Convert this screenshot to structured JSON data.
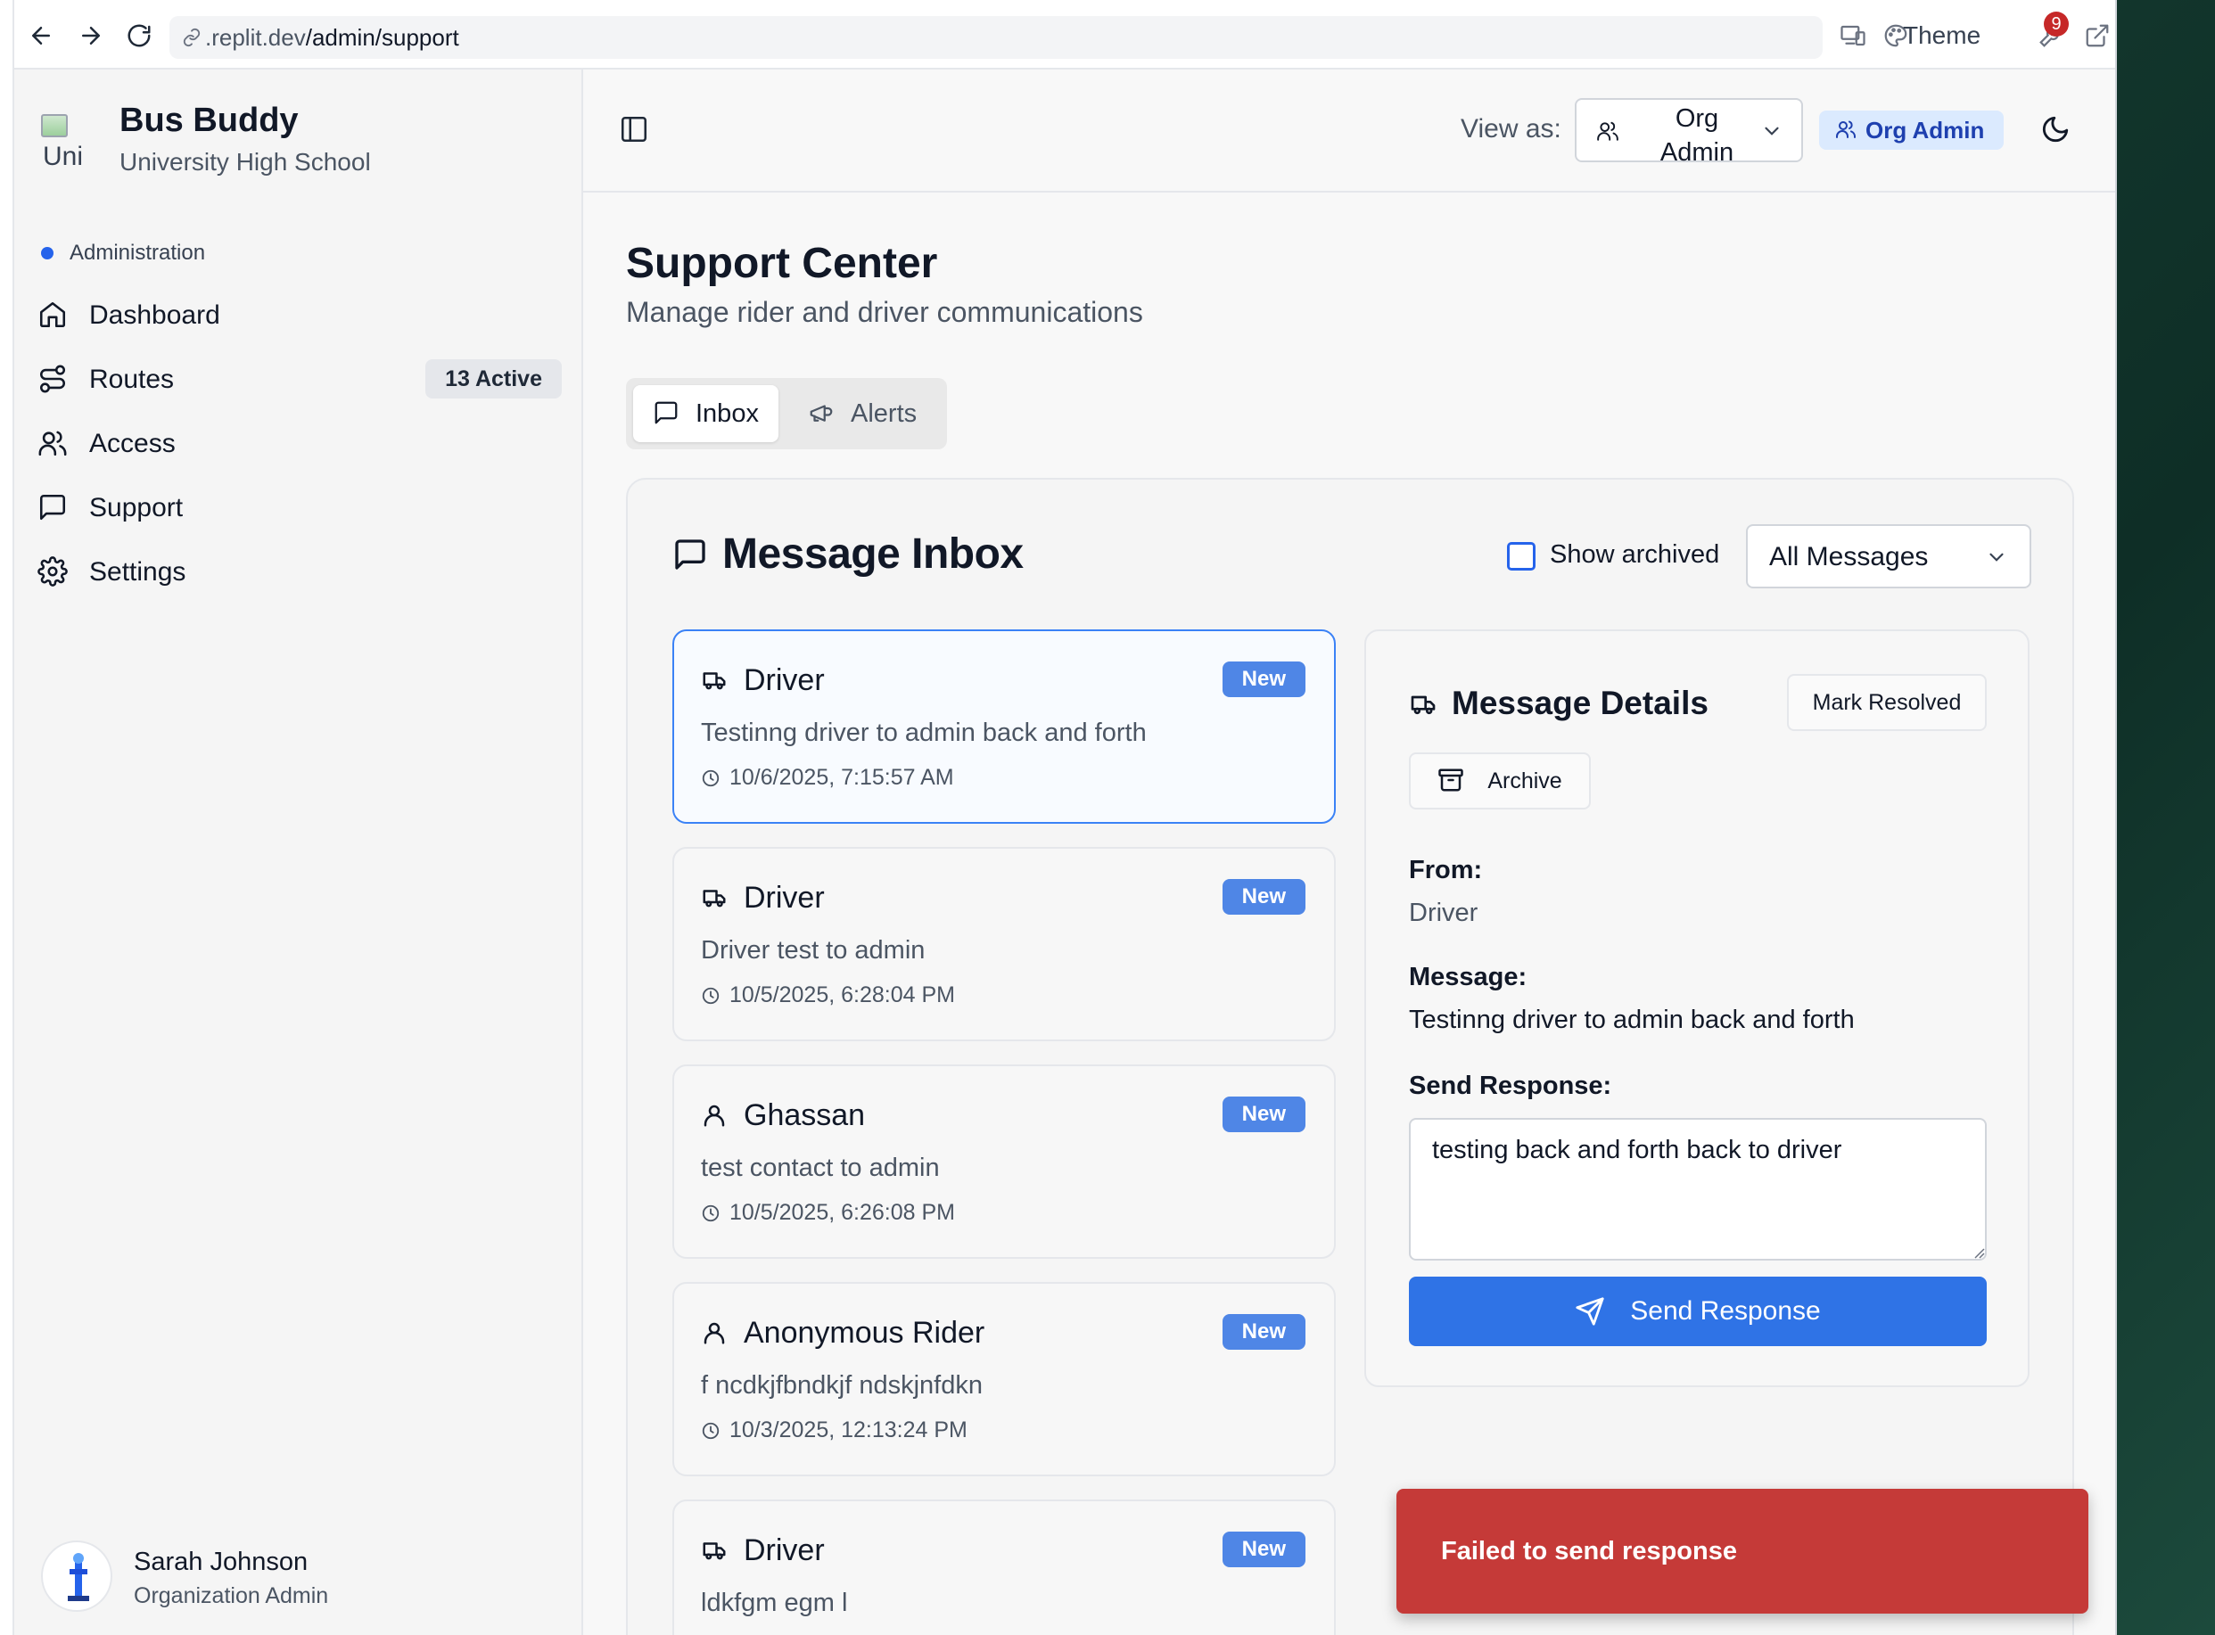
{
  "browser": {
    "url_host": ".replit.dev",
    "url_path": "/admin/support",
    "theme_label": "Theme",
    "notification_count": "9"
  },
  "sidebar": {
    "app_name": "Bus Buddy",
    "logo_alt": "Uni",
    "org_name": "University High School",
    "section_label": "Administration",
    "items": [
      {
        "label": "Dashboard",
        "icon": "home-icon"
      },
      {
        "label": "Routes",
        "icon": "route-icon",
        "badge": "13 Active"
      },
      {
        "label": "Access",
        "icon": "users-icon"
      },
      {
        "label": "Support",
        "icon": "message-square-icon"
      },
      {
        "label": "Settings",
        "icon": "gear-icon"
      }
    ],
    "user": {
      "name": "Sarah Johnson",
      "role": "Organization Admin"
    }
  },
  "header": {
    "view_as_label": "View as:",
    "view_as_value_line1": "Org",
    "view_as_value_line2": "Admin",
    "role_badge": "Org Admin"
  },
  "main": {
    "title": "Support Center",
    "subtitle": "Manage rider and driver communications",
    "tabs": [
      {
        "label": "Inbox",
        "active": true
      },
      {
        "label": "Alerts",
        "active": false
      }
    ],
    "inbox": {
      "title": "Message Inbox",
      "show_archived_label": "Show archived",
      "show_archived_checked": false,
      "filter_value": "All Messages"
    },
    "messages": [
      {
        "sender": "Driver",
        "icon": "truck-icon",
        "badge": "New",
        "text": "Testinng driver to admin back and forth",
        "time": "10/6/2025, 7:15:57 AM",
        "selected": true
      },
      {
        "sender": "Driver",
        "icon": "truck-icon",
        "badge": "New",
        "text": "Driver test to admin",
        "time": "10/5/2025, 6:28:04 PM"
      },
      {
        "sender": "Ghassan",
        "icon": "user-icon",
        "badge": "New",
        "text": "test contact to admin",
        "time": "10/5/2025, 6:26:08 PM"
      },
      {
        "sender": "Anonymous Rider",
        "icon": "user-icon",
        "badge": "New",
        "text": "f ncdkjfbndkjf ndskjnfdkn",
        "time": "10/3/2025, 12:13:24 PM"
      },
      {
        "sender": "Driver",
        "icon": "truck-icon",
        "badge": "New",
        "text": "ldkfgm egm l",
        "time": ""
      }
    ],
    "detail": {
      "title": "Message Details",
      "mark_resolved": "Mark Resolved",
      "archive": "Archive",
      "from_label": "From:",
      "from_value": "Driver",
      "message_label": "Message:",
      "message_value": "Testinng driver to admin back and forth",
      "response_label": "Send Response:",
      "response_value": "testing back and forth back to driver",
      "send_button": "Send Response"
    }
  },
  "toast": {
    "text": "Failed to send response"
  },
  "colors": {
    "accent": "#2f73e6",
    "badge": "#4f86e6",
    "toast": "#c53a38",
    "role_badge_bg": "#dbeafe"
  }
}
